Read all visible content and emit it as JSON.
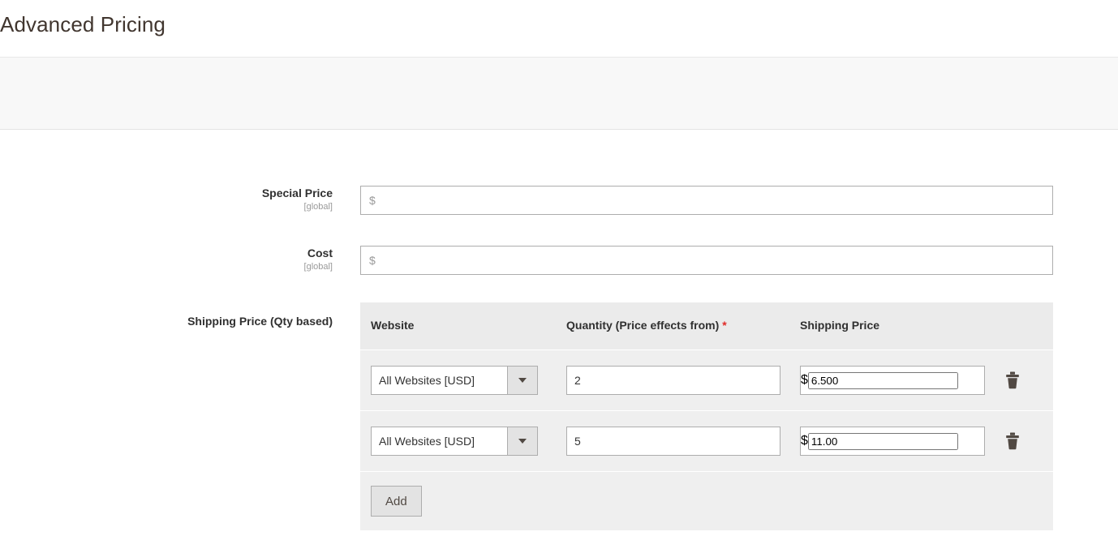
{
  "page": {
    "title": "Advanced Pricing"
  },
  "colors": {
    "title_text": "#41362f",
    "label_text": "#303030",
    "scope_text": "#999999",
    "required_asterisk": "#e02b27",
    "panel_bg": "#efefef",
    "panel_header_bg": "#ebebeb",
    "toolbar_strip_bg": "#f8f8f8",
    "input_border": "#adadad",
    "button_bg": "#e3e3e3",
    "trash_icon": "#514943"
  },
  "fields": {
    "special_price": {
      "label": "Special Price",
      "scope": "[global]",
      "currency_prefix": "$",
      "value": "",
      "placeholder": ""
    },
    "cost": {
      "label": "Cost",
      "scope": "[global]",
      "currency_prefix": "$",
      "value": "",
      "placeholder": ""
    },
    "shipping_price_qty": {
      "label": "Shipping Price (Qty based)"
    }
  },
  "shipping_table": {
    "columns": {
      "website": "Website",
      "quantity": "Quantity (Price effects from)",
      "quantity_required_marker": "*",
      "shipping_price": "Shipping Price"
    },
    "rows": [
      {
        "website": "All Websites [USD]",
        "quantity": "2",
        "currency_prefix": "$",
        "shipping_price": "6.500",
        "delete_icon": "trash-icon"
      },
      {
        "website": "All Websites [USD]",
        "quantity": "5",
        "currency_prefix": "$",
        "shipping_price": "11.00",
        "delete_icon": "trash-icon"
      }
    ],
    "add_button_label": "Add",
    "website_options": [
      "All Websites [USD]"
    ],
    "dropdown_icon": "chevron-down-icon"
  }
}
